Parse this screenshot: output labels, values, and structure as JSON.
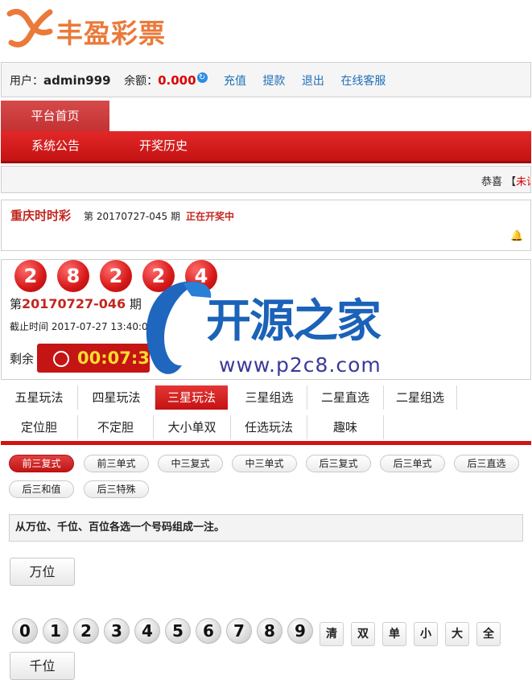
{
  "brand": {
    "name": "丰盈彩票"
  },
  "user": {
    "label": "用户：",
    "name": "admin999",
    "balance_label": "余额：",
    "balance": "0.000",
    "links": [
      "充值",
      "提款",
      "退出",
      "在线客服"
    ]
  },
  "nav": {
    "home": "平台首页",
    "items": [
      "系统公告",
      "开奖历史"
    ]
  },
  "marquee": {
    "prefix": "恭喜 【",
    "highlight": "未设"
  },
  "draw": {
    "lottery": "重庆时时彩",
    "prev_prefix": "第",
    "prev_issue": "20170727-045",
    "prev_suffix": "期",
    "status": "正在开奖中"
  },
  "result": {
    "balls": [
      "2",
      "8",
      "2",
      "2",
      "4"
    ],
    "issue_prefix": "第",
    "issue": "20170727-046",
    "issue_suffix": "期",
    "close_label": "截止时间",
    "close_time": "2017-07-27 13:40:0",
    "remain_label": "剩余",
    "countdown": "00:07:3"
  },
  "watermark": {
    "title": "开源之家",
    "url": "www.p2c8.com"
  },
  "tabs": {
    "row1": [
      "五星玩法",
      "四星玩法",
      "三星玩法",
      "三星组选",
      "二星直选",
      "二星组选"
    ],
    "row2": [
      "定位胆",
      "不定胆",
      "大小单双",
      "任选玩法",
      "趣味"
    ],
    "active": "三星玩法"
  },
  "options": {
    "row1": [
      "前三复式",
      "前三单式",
      "中三复式",
      "中三单式",
      "后三复式",
      "后三单式",
      "后三直选"
    ],
    "row2": [
      "后三和值",
      "后三特殊"
    ],
    "active": "前三复式"
  },
  "hint": "从万位、千位、百位各选一个号码组成一注。",
  "positions": [
    "万位",
    "千位"
  ],
  "numbers": [
    "0",
    "1",
    "2",
    "3",
    "4",
    "5",
    "6",
    "7",
    "8",
    "9"
  ],
  "quick": [
    "清",
    "双",
    "单",
    "小",
    "大",
    "全"
  ],
  "colors": {
    "brand_red": "#d11414",
    "link_blue": "#1e6fb8",
    "logo_orange": "#ea7a3a"
  },
  "icons": [
    "logo-icon",
    "refresh-icon",
    "bell-icon",
    "clock-icon"
  ]
}
